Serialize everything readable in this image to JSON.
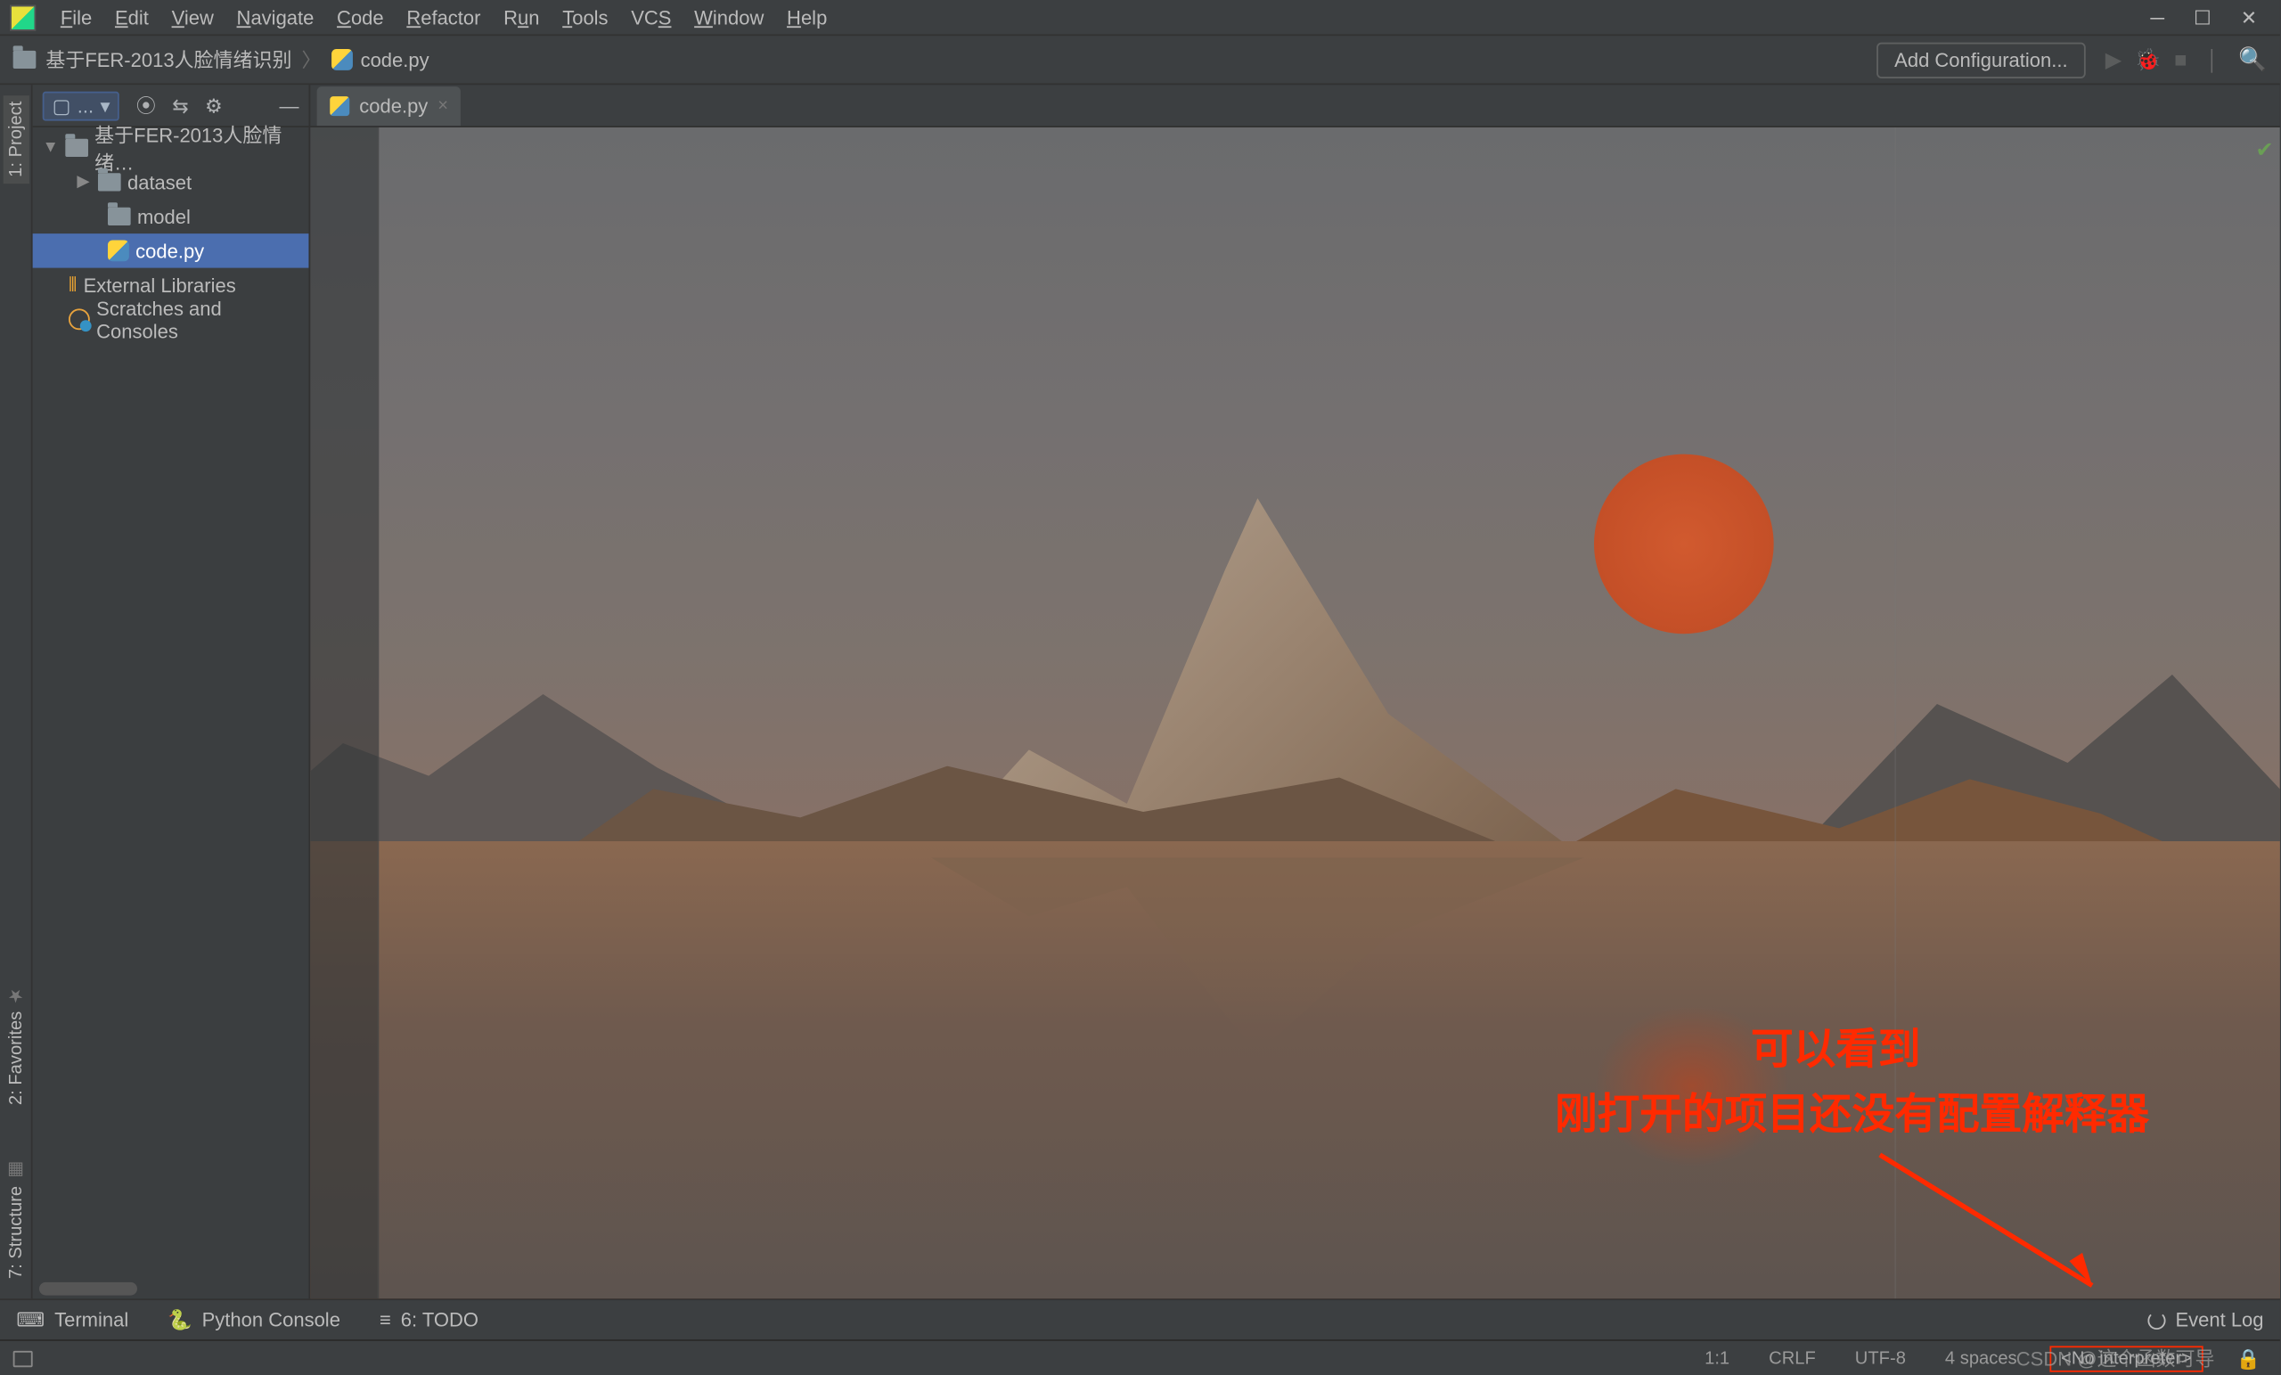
{
  "menu": {
    "items": [
      "File",
      "Edit",
      "View",
      "Navigate",
      "Code",
      "Refactor",
      "Run",
      "Tools",
      "VCS",
      "Window",
      "Help"
    ]
  },
  "breadcrumb": {
    "project": "基于FER-2013人脸情绪识别",
    "file": "code.py"
  },
  "toolbar_right": {
    "add_config": "Add Configuration..."
  },
  "left_tabs": {
    "project": "1: Project",
    "structure": "7: Structure",
    "favorites": "2: Favorites"
  },
  "project_header": {
    "label": "..."
  },
  "tree": {
    "root": "基于FER-2013人脸情绪…",
    "children": [
      {
        "name": "dataset",
        "type": "folder",
        "expandable": true
      },
      {
        "name": "model",
        "type": "folder",
        "expandable": false
      },
      {
        "name": "code.py",
        "type": "pyfile",
        "selected": true
      }
    ],
    "ext_lib": "External Libraries",
    "scratches": "Scratches and Consoles"
  },
  "editor": {
    "tab": "code.py"
  },
  "annotation": {
    "line1": "可以看到",
    "line2": "刚打开的项目还没有配置解释器"
  },
  "bottom_tools": {
    "terminal": "Terminal",
    "pyconsole": "Python Console",
    "todo": "6: TODO",
    "event_log": "Event Log"
  },
  "status": {
    "pos": "1:1",
    "eol": "CRLF",
    "enc": "UTF-8",
    "indent": "4 spaces",
    "interp": "<No interpreter>"
  },
  "watermark": "CSDN @这个函数可导"
}
